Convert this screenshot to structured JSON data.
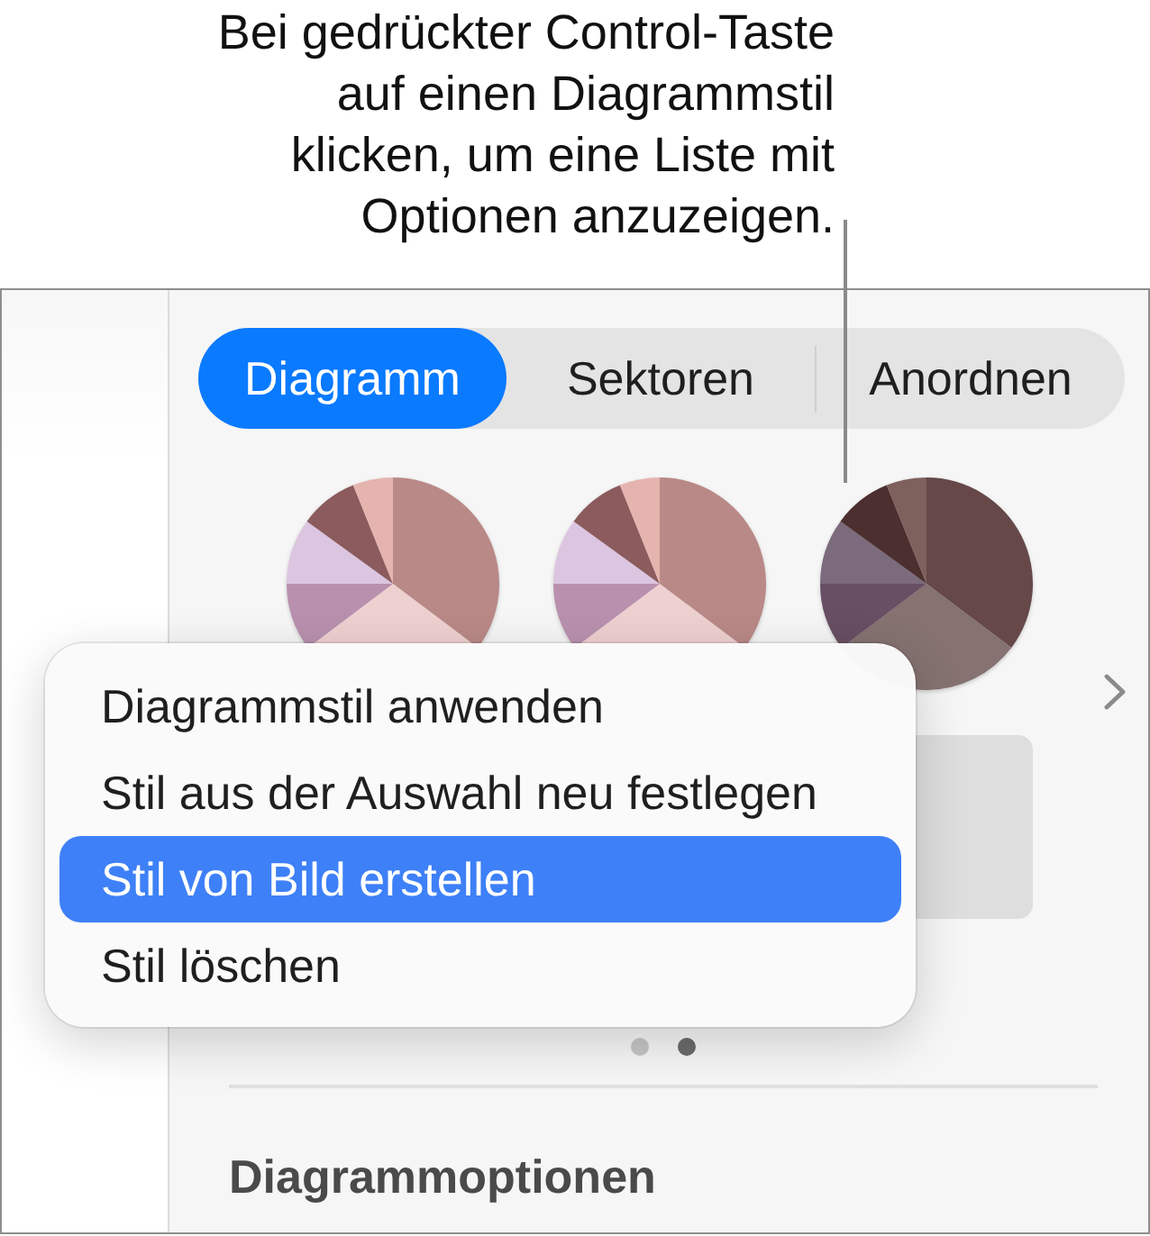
{
  "callout": {
    "lines": [
      "Bei gedrückter Control-Taste",
      "auf einen Diagrammstil",
      "klicken, um eine Liste mit",
      "Optionen anzuzeigen."
    ]
  },
  "tabs": [
    {
      "label": "Diagramm",
      "selected": true
    },
    {
      "label": "Sektoren",
      "selected": false
    },
    {
      "label": "Anordnen",
      "selected": false
    }
  ],
  "chart_styles": [
    {
      "slices": [
        {
          "color": "#b98987"
        },
        {
          "color": "#efd0d0"
        },
        {
          "color": "#b991ae"
        },
        {
          "color": "#dcc5e0"
        },
        {
          "color": "#8b5b5d"
        },
        {
          "color": "#e5b4ae"
        }
      ]
    },
    {
      "slices": [
        {
          "color": "#b98987"
        },
        {
          "color": "#efd0d0"
        },
        {
          "color": "#b991ae"
        },
        {
          "color": "#dcc5e0"
        },
        {
          "color": "#8b5b5d"
        },
        {
          "color": "#e5b4ae"
        }
      ]
    },
    {
      "slices": [
        {
          "color": "#664849"
        },
        {
          "color": "#857271"
        },
        {
          "color": "#684f63"
        },
        {
          "color": "#7b6b7c"
        },
        {
          "color": "#4c2f2f"
        },
        {
          "color": "#7e605d"
        }
      ]
    }
  ],
  "context_menu": {
    "items": [
      {
        "label": "Diagrammstil anwenden",
        "selected": false
      },
      {
        "label": "Stil aus der Auswahl neu festlegen",
        "selected": false
      },
      {
        "label": "Stil von Bild erstellen",
        "selected": true
      },
      {
        "label": "Stil löschen",
        "selected": false
      }
    ]
  },
  "pager": {
    "dots": [
      {
        "selected": false
      },
      {
        "selected": true
      }
    ]
  },
  "section": {
    "title": "Diagrammoptionen"
  }
}
